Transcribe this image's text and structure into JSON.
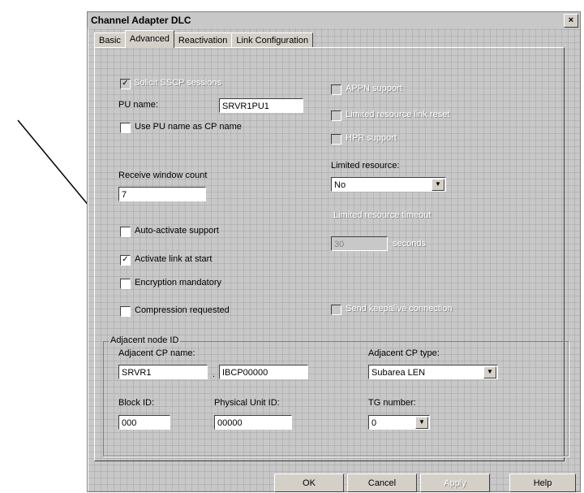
{
  "window": {
    "title": "Channel Adapter DLC"
  },
  "tabs": [
    "Basic",
    "Advanced",
    "Reactivation",
    "Link Configuration"
  ],
  "left": {
    "solicit_sscp_label": "Solicit SSCP sessions",
    "pu_name_label": "PU name:",
    "pu_name_value": "SRVR1PU1",
    "use_pu_name_label": "Use PU name as CP name",
    "receive_window_label": "Receive window count",
    "receive_window_value": "7",
    "auto_activate_label": "Auto-activate support",
    "activate_link_label": "Activate link at start",
    "encryption_label": "Encryption mandatory",
    "compression_label": "Compression requested"
  },
  "right": {
    "appn_label": "APPN support",
    "limited_resource_lbl_disabled": "Limited resource link reset",
    "hpr_label": "HPR support",
    "limited_resource_label": "Limited resource:",
    "limited_resource_value": "No",
    "timeout_label": "Limited resource timeout",
    "timeout_value": "30",
    "timeout_unit": "seconds",
    "send_keepalive_label": "Send keepalive connection"
  },
  "adjacent": {
    "group_label": "Adjacent node ID",
    "cp_name_label": "Adjacent CP name:",
    "cp_name_net": "SRVR1",
    "cp_name_cp": "IBCP00000",
    "cp_type_label": "Adjacent CP type:",
    "cp_type_value": "Subarea LEN",
    "block_id_label": "Block ID:",
    "block_id_value": "000",
    "pu_id_label": "Physical Unit ID:",
    "pu_id_value": "00000",
    "tg_label": "TG number:",
    "tg_value": "0"
  },
  "buttons": {
    "ok": "OK",
    "cancel": "Cancel",
    "apply": "Apply",
    "help": "Help"
  },
  "checks": {
    "checked": "✓"
  }
}
